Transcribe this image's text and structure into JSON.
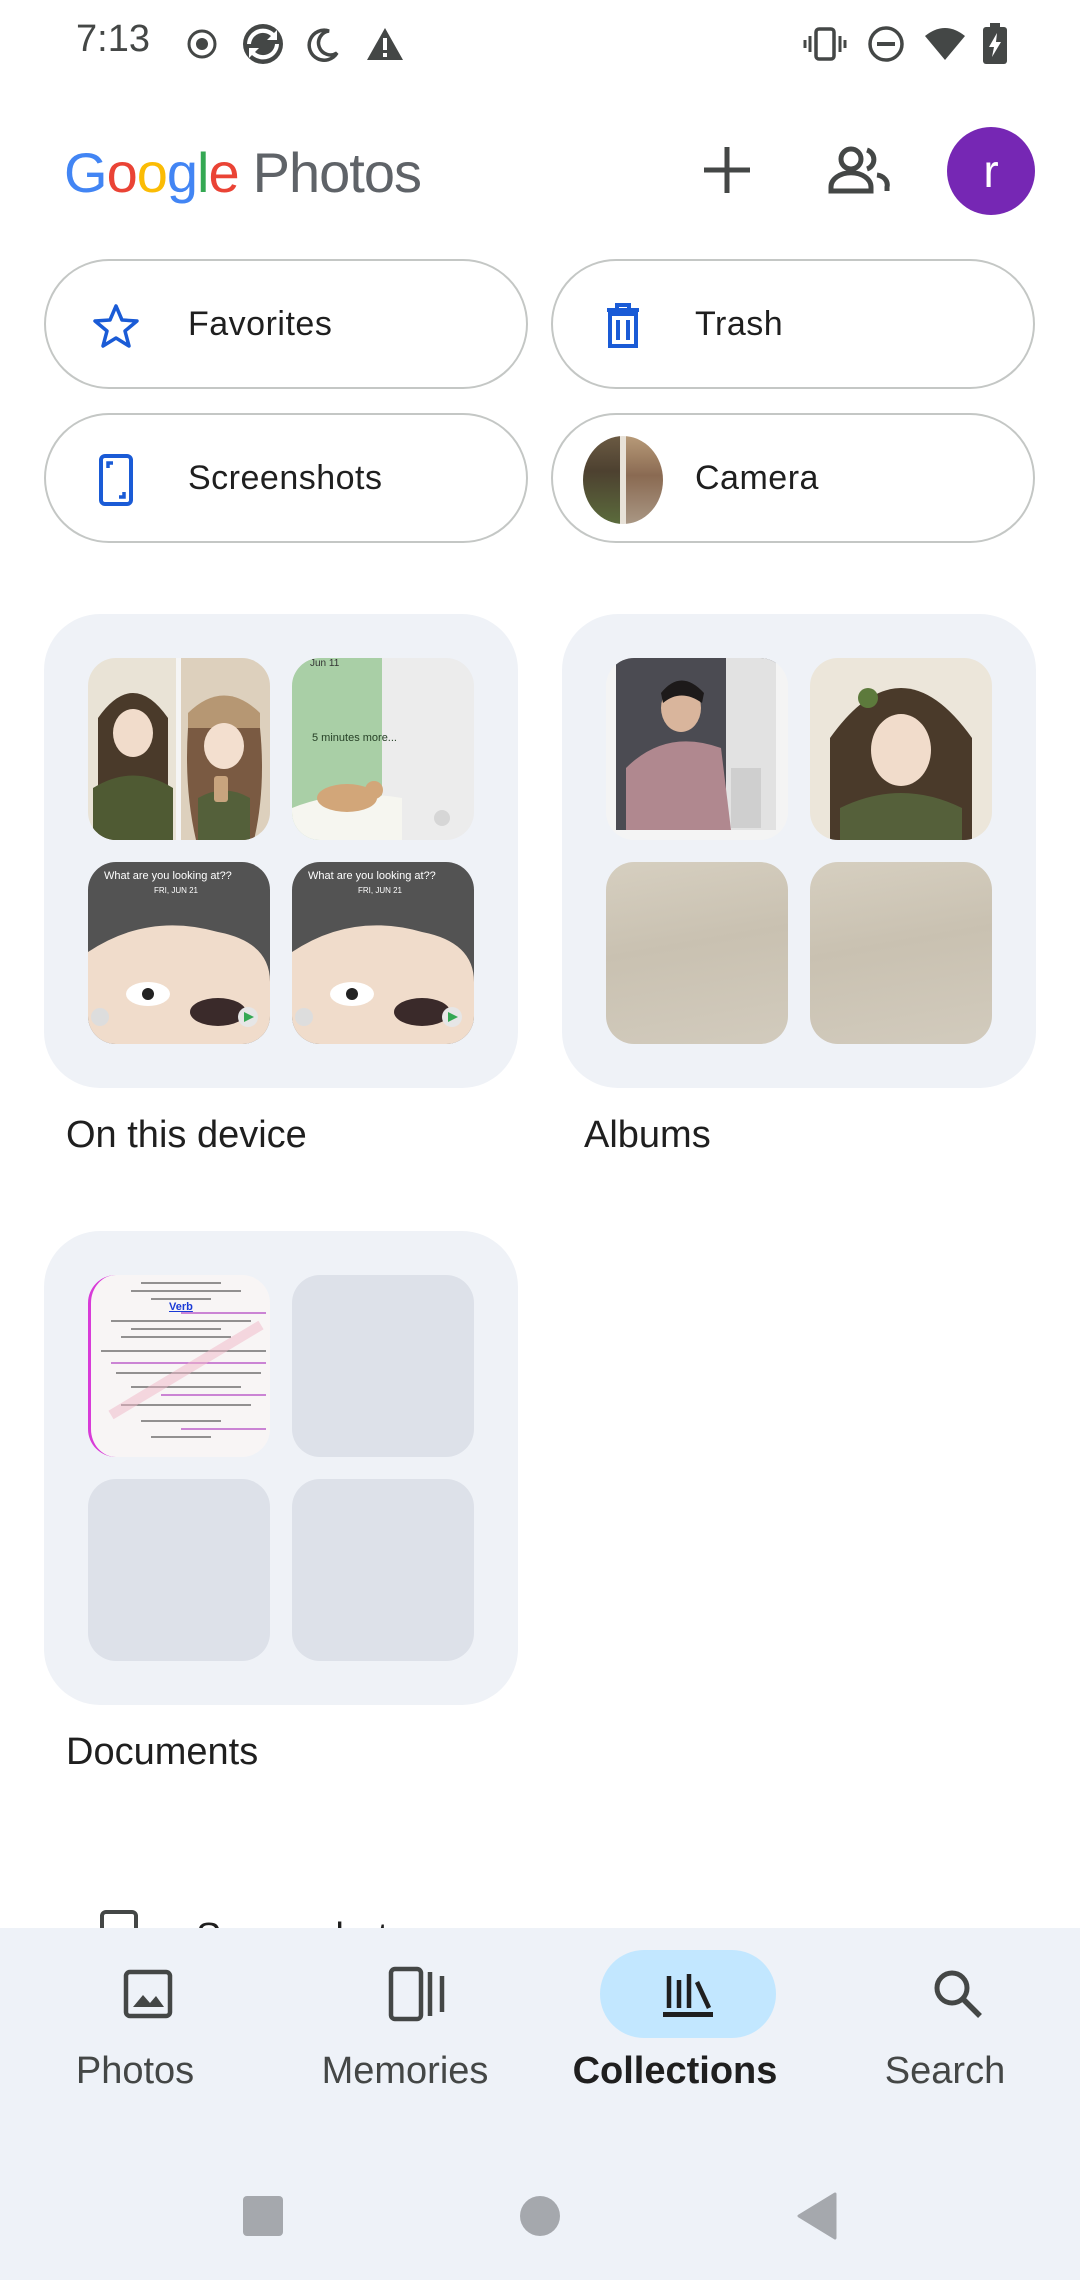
{
  "status_bar": {
    "time": "7:13",
    "left_icons": [
      "record-icon",
      "sync-icon",
      "do-not-disturb-moon-icon",
      "warning-icon"
    ],
    "right_icons": [
      "vibrate-icon",
      "dnd-icon",
      "wifi-icon",
      "battery-charging-icon"
    ]
  },
  "header": {
    "logo_word": "Google",
    "logo_product": "Photos",
    "add_icon": "plus-icon",
    "sharing_icon": "people-icon",
    "avatar_letter": "r",
    "avatar_color": "#7627b4"
  },
  "chips": [
    {
      "label": "Favorites",
      "icon": "star-icon"
    },
    {
      "label": "Trash",
      "icon": "trash-icon"
    },
    {
      "label": "Screenshots",
      "icon": "phone-screenshot-icon"
    },
    {
      "label": "Camera",
      "icon": "camera-thumbnail"
    }
  ],
  "collections": [
    {
      "label": "On this device",
      "thumb_texts": [
        "",
        "5 minutes more...",
        "What are you looking at??",
        "What are you looking at??"
      ],
      "dates": [
        "",
        "Jun 11",
        "FRI, JUN 21",
        "FRI, JUN 21"
      ]
    },
    {
      "label": "Albums"
    },
    {
      "label": "Documents",
      "doc_heading": "Verb"
    }
  ],
  "peek": {
    "label": "Screenshots",
    "icon": "phone-screenshot-icon"
  },
  "bottom_nav": [
    {
      "label": "Photos",
      "icon": "image-icon",
      "active": false
    },
    {
      "label": "Memories",
      "icon": "memories-icon",
      "active": false
    },
    {
      "label": "Collections",
      "icon": "collections-icon",
      "active": true
    },
    {
      "label": "Search",
      "icon": "search-icon",
      "active": false
    }
  ],
  "colors": {
    "accent": "#1a5bd6",
    "active_pill": "#c2e7ff",
    "nav_background": "#eef2f8",
    "card_background": "#eff2f7"
  }
}
